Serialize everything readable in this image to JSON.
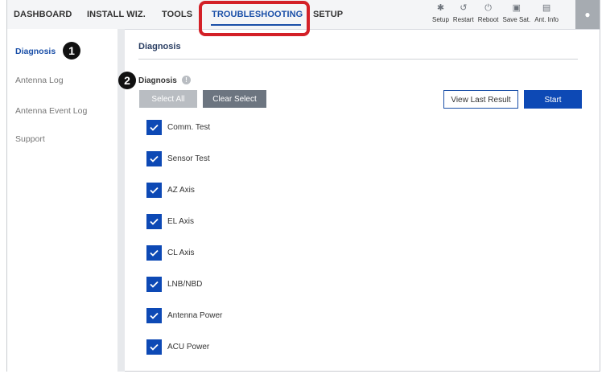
{
  "nav": {
    "items": [
      "DASHBOARD",
      "INSTALL WIZ.",
      "TOOLS",
      "TROUBLESHOOTING",
      "SETUP"
    ],
    "active": "TROUBLESHOOTING",
    "tools": [
      {
        "icon": "gear-icon",
        "label": "Setup"
      },
      {
        "icon": "restart-icon",
        "label": "Restart"
      },
      {
        "icon": "power-icon",
        "label": "Reboot"
      },
      {
        "icon": "save-icon",
        "label": "Save Sat."
      },
      {
        "icon": "antenna-info-icon",
        "label": "Ant. Info"
      }
    ],
    "user_icon": "user-icon"
  },
  "sidebar": {
    "items": [
      "Diagnosis",
      "Antenna Log",
      "Antenna Event Log",
      "Support"
    ],
    "active": "Diagnosis"
  },
  "callouts": [
    "1",
    "2"
  ],
  "main": {
    "title": "Diagnosis",
    "section_label": "Diagnosis",
    "info_glyph": "!",
    "buttons": {
      "select_all": "Select All",
      "clear_select": "Clear Select",
      "view_last_result": "View Last Result",
      "start": "Start"
    },
    "tests": [
      {
        "label": "Comm. Test",
        "checked": true
      },
      {
        "label": "Sensor Test",
        "checked": true
      },
      {
        "label": "AZ Axis",
        "checked": true
      },
      {
        "label": "EL Axis",
        "checked": true
      },
      {
        "label": "CL Axis",
        "checked": true
      },
      {
        "label": "LNB/NBD",
        "checked": true
      },
      {
        "label": "Antenna Power",
        "checked": true
      },
      {
        "label": "ACU Power",
        "checked": true
      }
    ]
  },
  "colors": {
    "accent": "#1a4fa8",
    "checkbox": "#0d49b5",
    "highlight": "#d32027",
    "select_all_bg": "#b9bdc2",
    "clear_bg": "#6c7580"
  }
}
